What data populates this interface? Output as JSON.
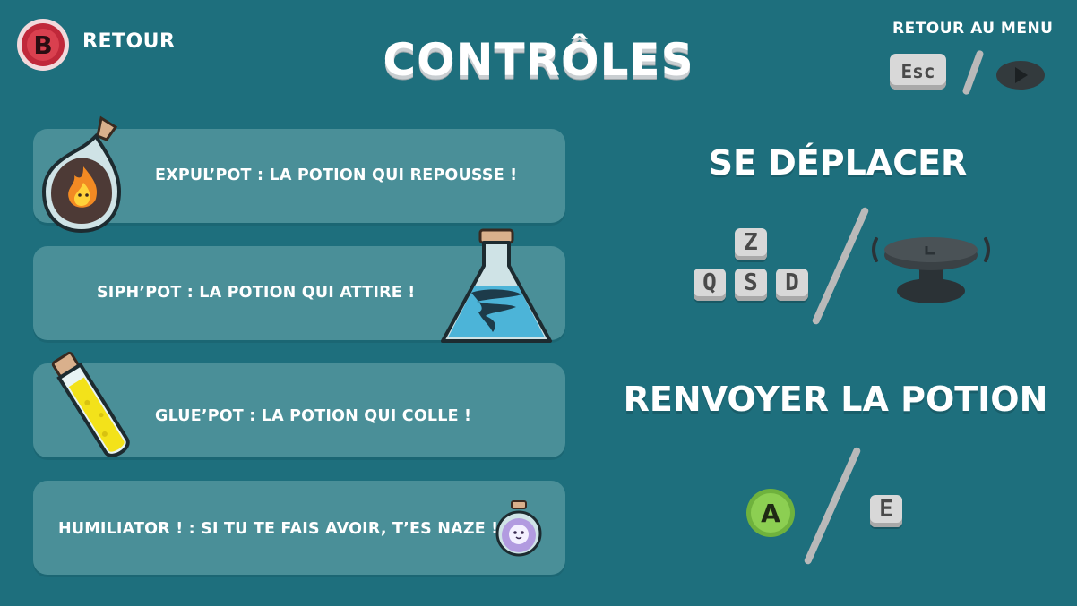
{
  "header": {
    "back_button_glyph": "B",
    "back_label": "RETOUR",
    "title": "CONTRÔLES",
    "menu_label": "RETOUR AU MENU",
    "menu_key": "Esc"
  },
  "potions": [
    {
      "label": "EXPUL’POT : LA POTION QUI REPOUSSE !",
      "icon": "fire-potion-icon"
    },
    {
      "label": "SIPH’POT : LA POTION QUI ATTIRE !",
      "icon": "tornado-flask-icon"
    },
    {
      "label": "GLUE’POT : LA POTION QUI COLLE !",
      "icon": "glue-tube-icon"
    },
    {
      "label": "HUMILIATOR ! : SI TU TE FAIS AVOIR, T’ES NAZE !",
      "icon": "ghost-potion-icon"
    }
  ],
  "controls": {
    "move": {
      "title": "SE DÉPLACER",
      "keys": [
        "Z",
        "Q",
        "S",
        "D"
      ]
    },
    "throw": {
      "title": "RENVOYER LA POTION",
      "gamepad_button": "A",
      "key": "E"
    }
  },
  "colors": {
    "background": "#1e6f7d",
    "row": "#4a8f98",
    "back_button": "#c0283a",
    "a_button": "#7cc242"
  }
}
